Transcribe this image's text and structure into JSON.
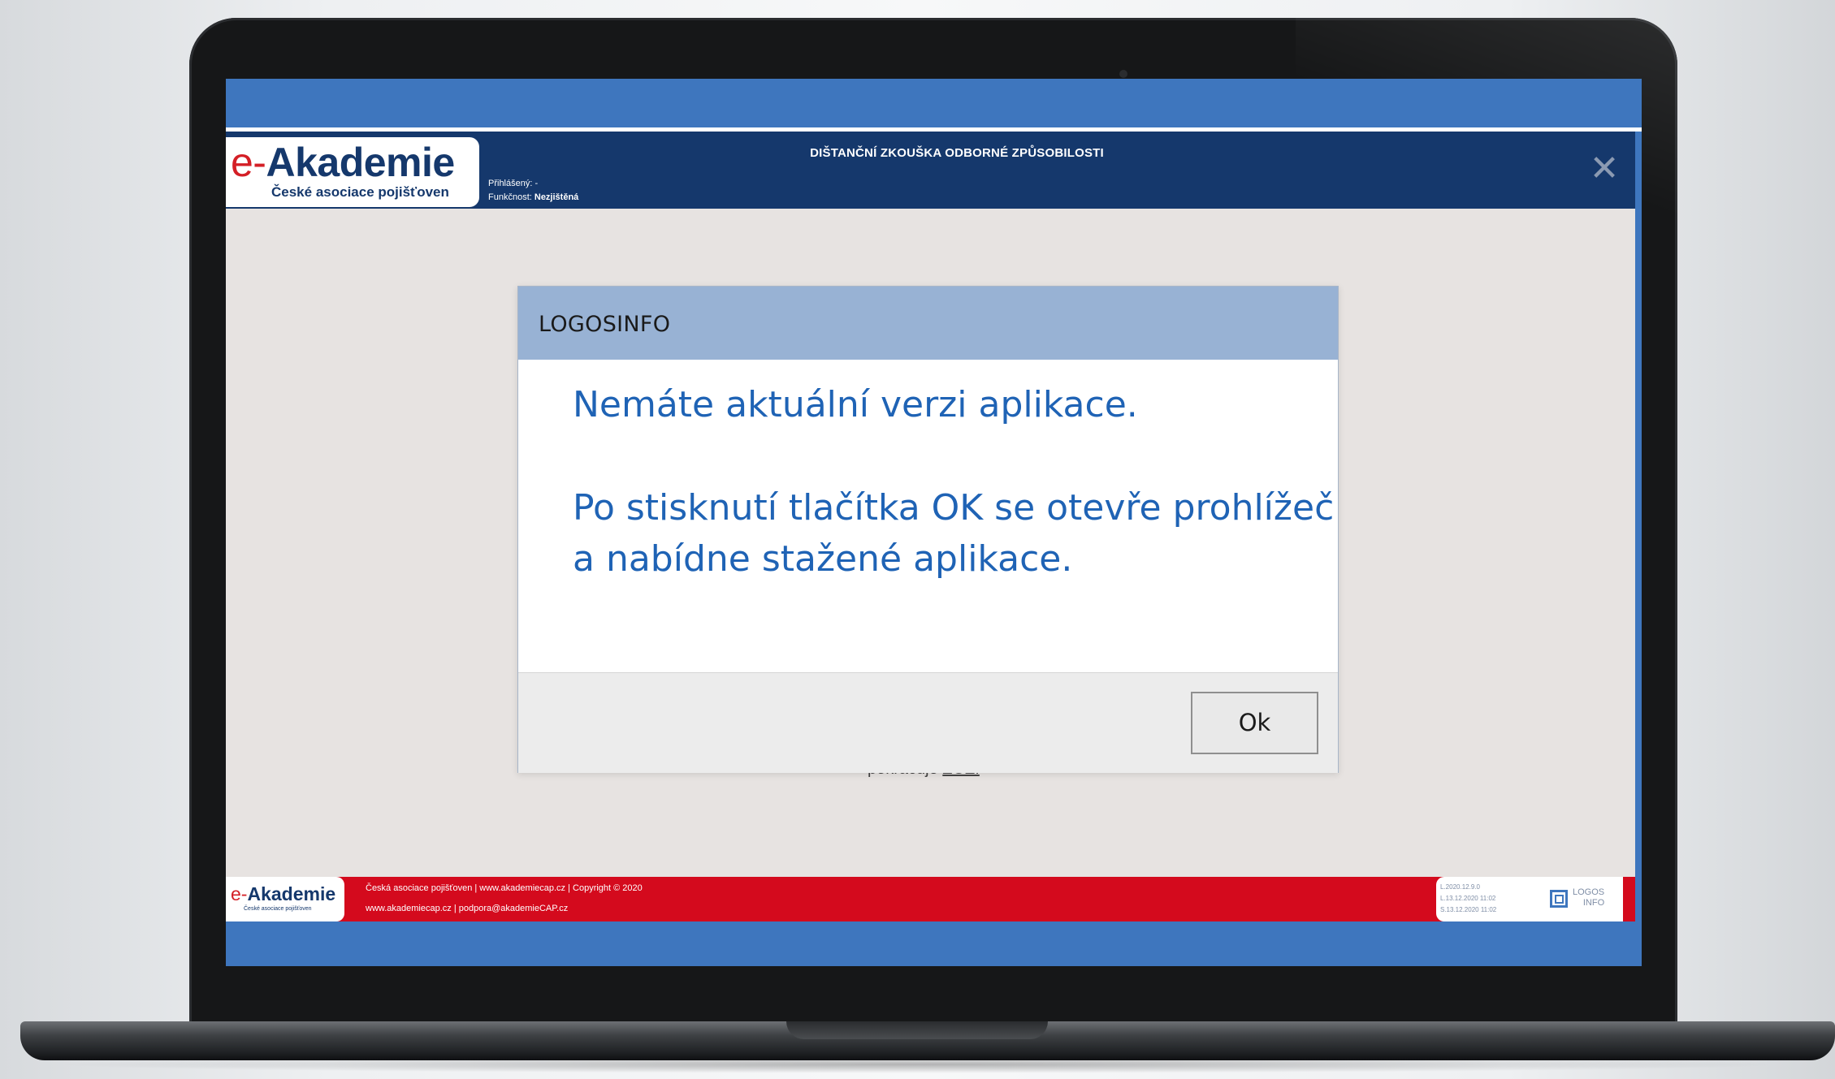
{
  "app": {
    "logo_prefix": "e-",
    "logo_name": "Akademie",
    "logo_subtitle": "České asociace pojišťoven",
    "login_label": "Přihlášený:",
    "login_value": "-",
    "function_label": "Funkčnost:",
    "function_value": "Nezjištěná",
    "header_title": "DIŠTANČNÍ ZKOUŠKA ODBORNÉ ZPŮSOBILOSTI",
    "close_glyph": "✕"
  },
  "background": {
    "partial_text": "pokračuje ",
    "partial_link": "ZOZ."
  },
  "dialog": {
    "title": "LOGOSINFO",
    "message_line1": "Nemáte aktuální verzi aplikace.",
    "message_line2": "Po stisknutí tlačítka OK se otevře prohlížeč",
    "message_line3": "a nabídne stažené aplikace.",
    "ok_label": "Ok"
  },
  "footer": {
    "logo_prefix": "e-",
    "logo_name": "Akademie",
    "logo_subtitle": "České asociace pojišťoven",
    "line1": "Česká asociace pojišťoven | www.akademiecap.cz | Copyright © 2020",
    "line2": "www.akademiecap.cz | podpora@akademieCAP.cz",
    "versions": [
      "L.2020.12.9.0",
      "L.13.12.2020 11:02",
      "S.13.12.2020 11:02"
    ],
    "brand_line1": "LOGOS",
    "brand_line2": "INFO"
  },
  "colors": {
    "header_blue": "#15386c",
    "band_blue": "#3e76be",
    "footer_red": "#d40a1d",
    "dialog_title_bg": "#98b2d4",
    "message_blue": "#1f63b5"
  }
}
